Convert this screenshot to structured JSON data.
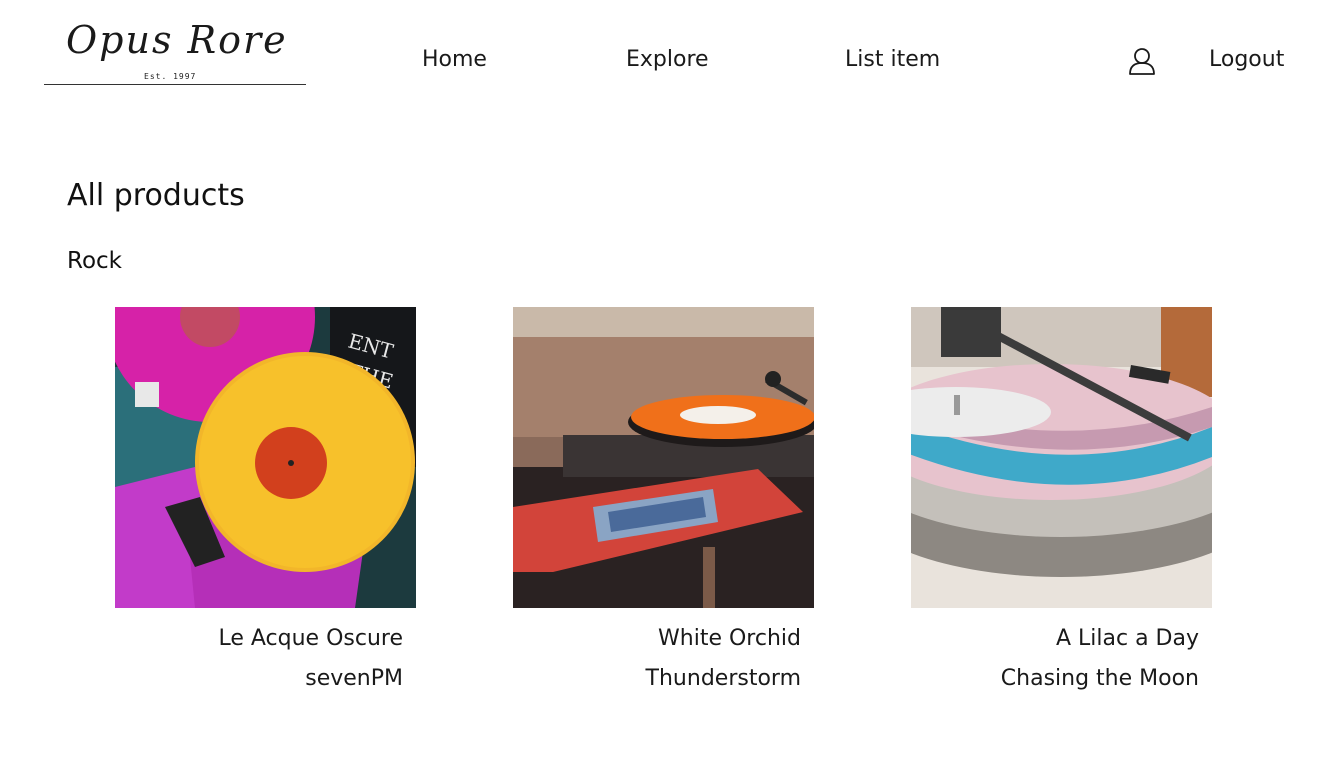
{
  "brand": {
    "name": "Opus Rore",
    "tagline": "Est. 1997"
  },
  "nav": {
    "home": "Home",
    "explore": "Explore",
    "list_item": "List item",
    "user_icon": "user-icon",
    "logout": "Logout"
  },
  "main": {
    "title": "All products",
    "section": "Rock"
  },
  "products": [
    {
      "title": "Le Acque Oscure",
      "artist": "sevenPM",
      "image": "yellow-vinyl-record-photo"
    },
    {
      "title": "White Orchid",
      "artist": "Thunderstorm",
      "image": "orange-vinyl-turntable-photo"
    },
    {
      "title": "A Lilac a Day",
      "artist": "Chasing the Moon",
      "image": "blue-pink-vinyl-turntable-photo"
    }
  ]
}
